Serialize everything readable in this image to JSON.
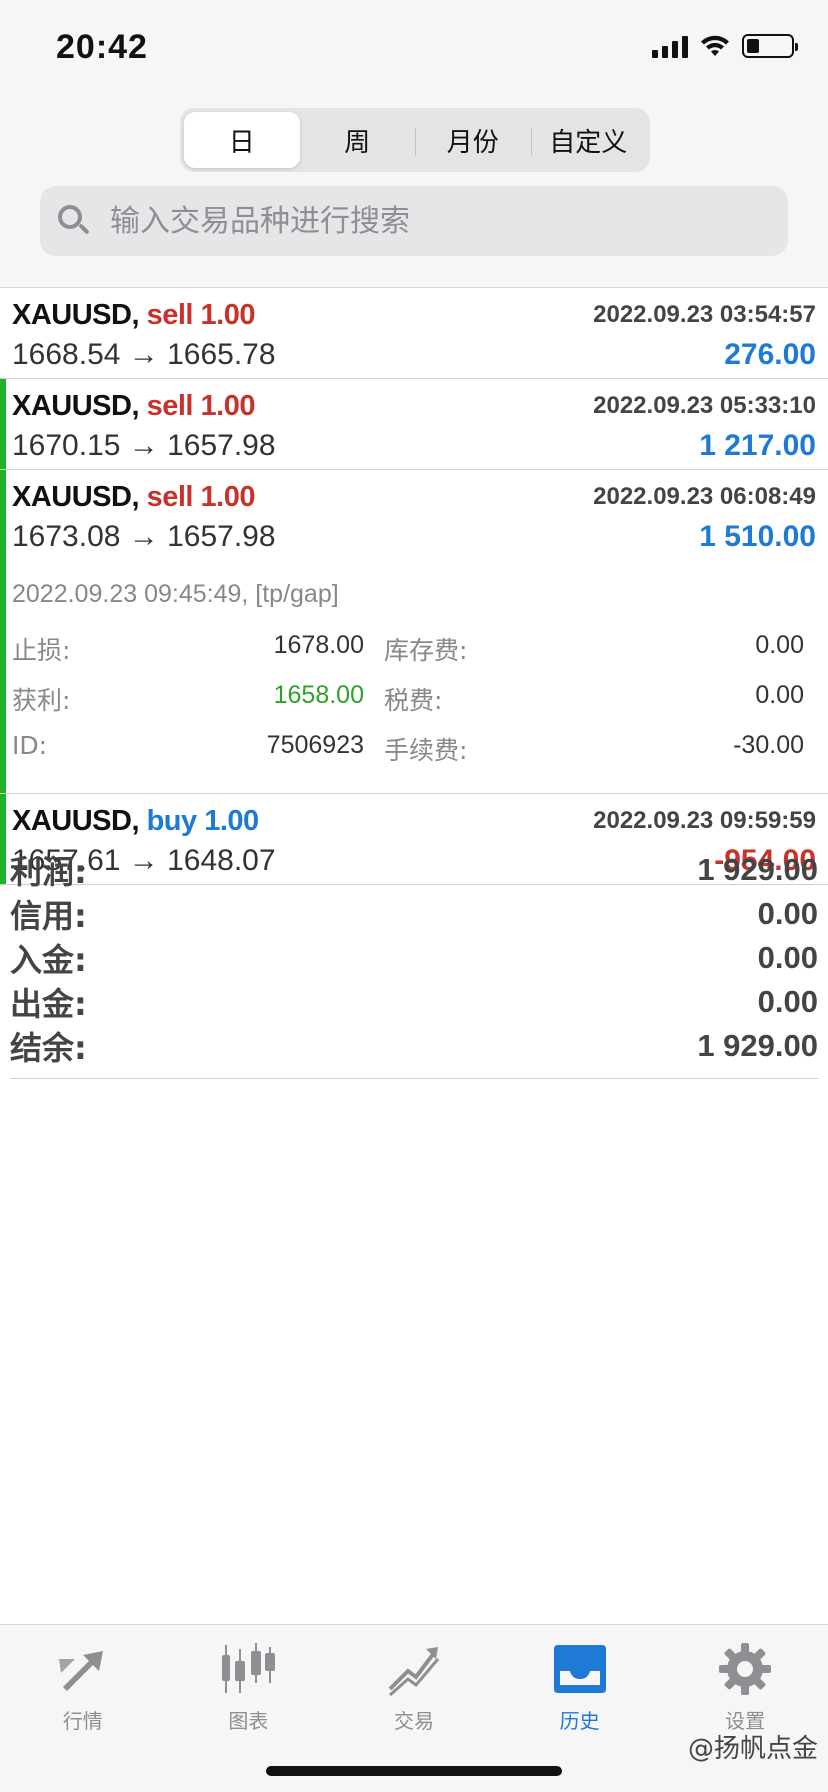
{
  "status_bar": {
    "time": "20:42"
  },
  "period_tabs": [
    {
      "label": "日",
      "active": true
    },
    {
      "label": "周",
      "active": false
    },
    {
      "label": "月份",
      "active": false
    },
    {
      "label": "自定义",
      "active": false
    }
  ],
  "search": {
    "placeholder": "输入交易品种进行搜索"
  },
  "trades": [
    {
      "symbol": "XAUUSD,",
      "direction": "sell 1.00",
      "side": "sell",
      "time": "2022.09.23 03:54:57",
      "prices": "1668.54 → 1665.78",
      "profit": "276.00"
    },
    {
      "symbol": "XAUUSD,",
      "direction": "sell 1.00",
      "side": "sell",
      "time": "2022.09.23 05:33:10",
      "prices": "1670.15 → 1657.98",
      "profit": "1 217.00"
    },
    {
      "symbol": "XAUUSD,",
      "direction": "sell 1.00",
      "side": "sell",
      "time": "2022.09.23 06:08:49",
      "prices": "1673.08 → 1657.98",
      "profit": "1 510.00",
      "details": {
        "close_info": "2022.09.23 09:45:49, [tp/gap]",
        "stop_loss_label": "止损:",
        "stop_loss": "1678.00",
        "swap_label": "库存费:",
        "swap": "0.00",
        "take_profit_label": "获利:",
        "take_profit": "1658.00",
        "tax_label": "税费:",
        "tax": "0.00",
        "id_label": "ID:",
        "id": "7506923",
        "commission_label": "手续费:",
        "commission": "-30.00"
      }
    },
    {
      "symbol": "XAUUSD,",
      "direction": "buy 1.00",
      "side": "buy",
      "time": "2022.09.23 09:59:59",
      "prices": "1657.61 → 1648.07",
      "profit": "-954.00"
    }
  ],
  "summary": [
    {
      "label": "利润:",
      "value": "1 929.00"
    },
    {
      "label": "信用:",
      "value": "0.00"
    },
    {
      "label": "入金:",
      "value": "0.00"
    },
    {
      "label": "出金:",
      "value": "0.00"
    },
    {
      "label": "结余:",
      "value": "1 929.00"
    }
  ],
  "tabbar": [
    {
      "label": "行情",
      "icon": "quotes-arrows-icon",
      "active": false
    },
    {
      "label": "图表",
      "icon": "candlestick-chart-icon",
      "active": false
    },
    {
      "label": "交易",
      "icon": "trade-trend-icon",
      "active": false
    },
    {
      "label": "历史",
      "icon": "history-inbox-icon",
      "active": true
    },
    {
      "label": "设置",
      "icon": "gear-icon",
      "active": false
    }
  ],
  "watermark": "@扬帆点金",
  "colors": {
    "accent": "#1f7ad6",
    "sell": "#c8322b",
    "gain": "#2ea12b"
  }
}
